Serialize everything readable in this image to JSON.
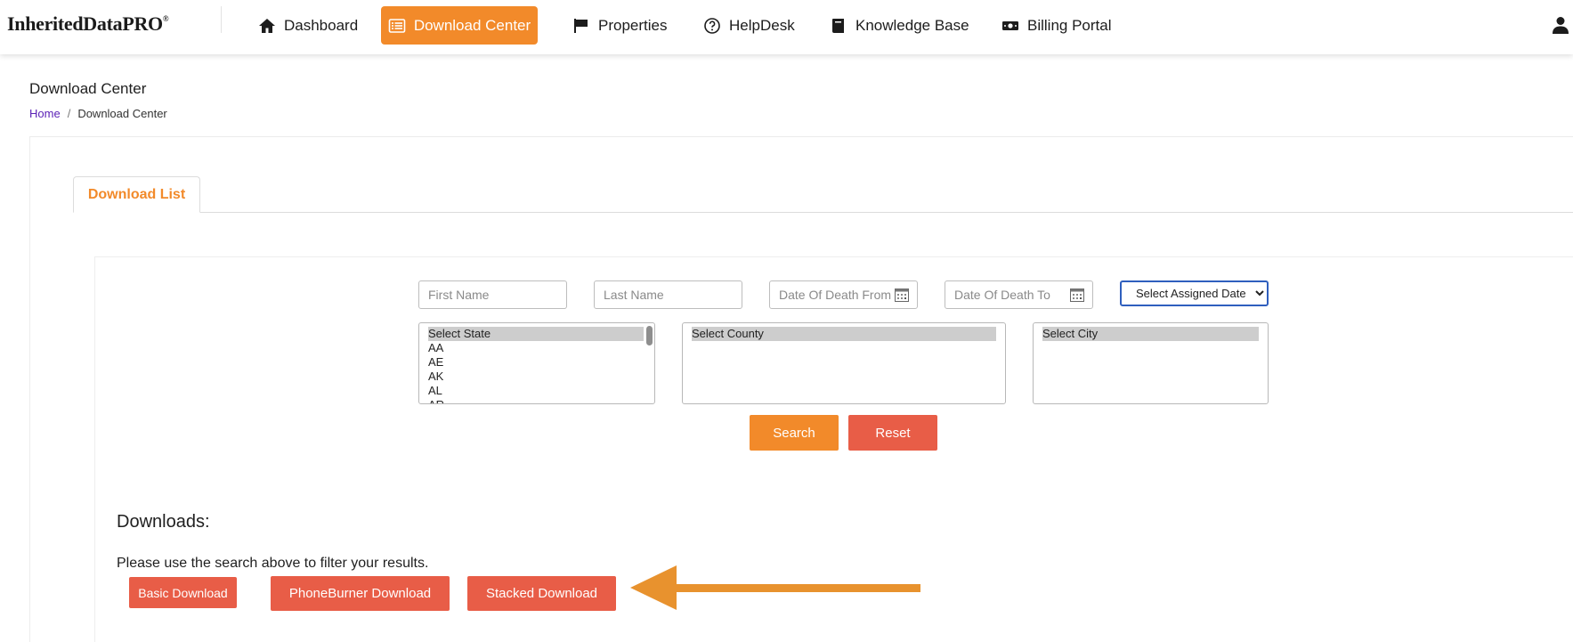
{
  "nav": {
    "logo": "InheritedDataPRO",
    "logo_mark": "®",
    "items": [
      {
        "label": "Dashboard",
        "icon": "home-icon"
      },
      {
        "label": "Download Center",
        "icon": "list-icon"
      },
      {
        "label": "Properties",
        "icon": "flag-icon"
      },
      {
        "label": "HelpDesk",
        "icon": "question-circle-icon"
      },
      {
        "label": "Knowledge Base",
        "icon": "book-icon"
      },
      {
        "label": "Billing Portal",
        "icon": "money-bill-icon"
      }
    ],
    "active_item": "Download Center",
    "user_icon": "user-icon"
  },
  "page": {
    "title": "Download Center",
    "breadcrumb": [
      "Home",
      "Download Center"
    ],
    "breadcrumb_separator": "/"
  },
  "tabs": [
    {
      "label": "Download List",
      "active": true
    }
  ],
  "filters": {
    "first_name_placeholder": "First Name",
    "last_name_placeholder": "Last Name",
    "dod_from_placeholder": "Date Of Death From",
    "dod_to_placeholder": "Date Of Death To",
    "assigned_date_selected": "Select Assigned Date",
    "state_options": [
      "Select State",
      "AA",
      "AE",
      "AK",
      "AL",
      "AR"
    ],
    "county_options": [
      "Select County"
    ],
    "city_options": [
      "Select City"
    ],
    "search_label": "Search",
    "reset_label": "Reset"
  },
  "downloads": {
    "title": "Downloads:",
    "note": "Please use the search above to filter your results.",
    "basic_label": "Basic Download",
    "phoneburner_label": "PhoneBurner Download",
    "stacked_label": "Stacked Download"
  },
  "colors": {
    "accent": "#f28a2a",
    "danger": "#e85d47",
    "arrow": "#e8922e",
    "focus_border": "#2f5fbe",
    "link": "#5b21b6"
  }
}
